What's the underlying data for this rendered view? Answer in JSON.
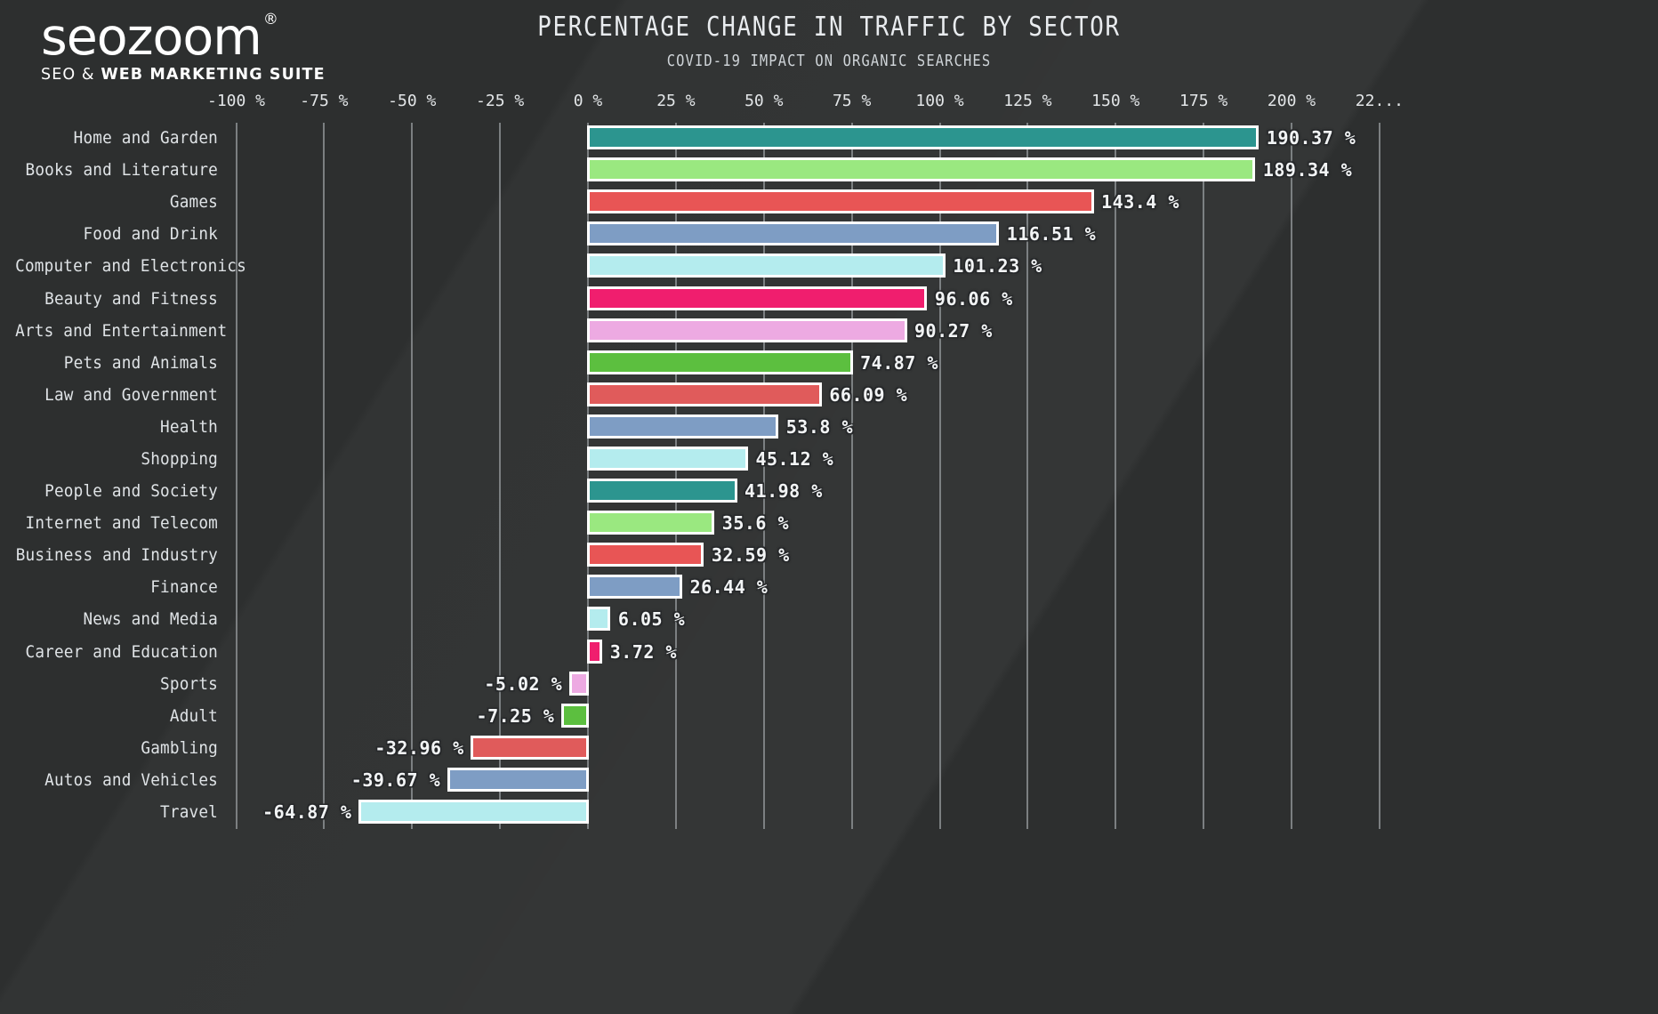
{
  "logo": {
    "word": "seozoom",
    "registered": "®",
    "tagline_light": "SEO &",
    "tagline_bold": "WEB MARKETING SUITE"
  },
  "header": {
    "title": "PERCENTAGE CHANGE IN TRAFFIC BY SECTOR",
    "subtitle": "COVID-19 IMPACT ON ORGANIC SEARCHES"
  },
  "chart_data": {
    "type": "bar",
    "orientation": "horizontal",
    "title": "PERCENTAGE CHANGE IN TRAFFIC BY SECTOR",
    "subtitle": "COVID-19 IMPACT ON ORGANIC SEARCHES",
    "xlabel": "",
    "ylabel": "",
    "xlim": [
      -100,
      225
    ],
    "grid": true,
    "legend": "none",
    "xticks": [
      -100,
      -75,
      -50,
      -25,
      0,
      25,
      50,
      75,
      100,
      125,
      150,
      175,
      200,
      225
    ],
    "xtick_labels": [
      "-100 %",
      "-75 %",
      "-50 %",
      "-25 %",
      "0 %",
      "25 %",
      "50 %",
      "75 %",
      "100 %",
      "125 %",
      "150 %",
      "175 %",
      "200 %",
      "22..."
    ],
    "categories": [
      "Home and Garden",
      "Books and Literature",
      "Games",
      "Food and Drink",
      "Computer and Electronics",
      "Beauty and Fitness",
      "Arts and Entertainment",
      "Pets and Animals",
      "Law and Government",
      "Health",
      "Shopping",
      "People and Society",
      "Internet and Telecom",
      "Business and Industry",
      "Finance",
      "News and Media",
      "Career and Education",
      "Sports",
      "Adult",
      "Gambling",
      "Autos and Vehicles",
      "Travel"
    ],
    "values": [
      190.37,
      189.34,
      143.4,
      116.51,
      101.23,
      96.06,
      90.27,
      74.87,
      66.09,
      53.8,
      45.12,
      41.98,
      35.6,
      32.59,
      26.44,
      6.05,
      3.72,
      -5.02,
      -7.25,
      -32.96,
      -39.67,
      -64.87
    ],
    "value_labels": [
      "190.37 %",
      "189.34 %",
      "143.4 %",
      "116.51 %",
      "101.23 %",
      "96.06 %",
      "90.27 %",
      "74.87 %",
      "66.09 %",
      "53.8 %",
      "45.12 %",
      "41.98 %",
      "35.6 %",
      "32.59 %",
      "26.44 %",
      "6.05 %",
      "3.72 %",
      "-5.02 %",
      "-7.25 %",
      "-32.96 %",
      "-39.67 %",
      "-64.87 %"
    ],
    "colors": [
      "#2c958f",
      "#9ae880",
      "#e85555",
      "#7e9dc4",
      "#b4ecee",
      "#f01e6e",
      "#edaae2",
      "#5cbf3f",
      "#e05b5b",
      "#7e9dc4",
      "#b4ecee",
      "#2c958f",
      "#9ae880",
      "#e85555",
      "#7e9dc4",
      "#b4ecee",
      "#f01e6e",
      "#edaae2",
      "#5cbf3f",
      "#e05b5b",
      "#7e9dc4",
      "#b4ecee"
    ],
    "bar_border_color": "#ffffff"
  },
  "style": {
    "background": "#2d2f2f",
    "gridline_color": "#8a8d8f",
    "text_color": "#e3e6e8"
  }
}
